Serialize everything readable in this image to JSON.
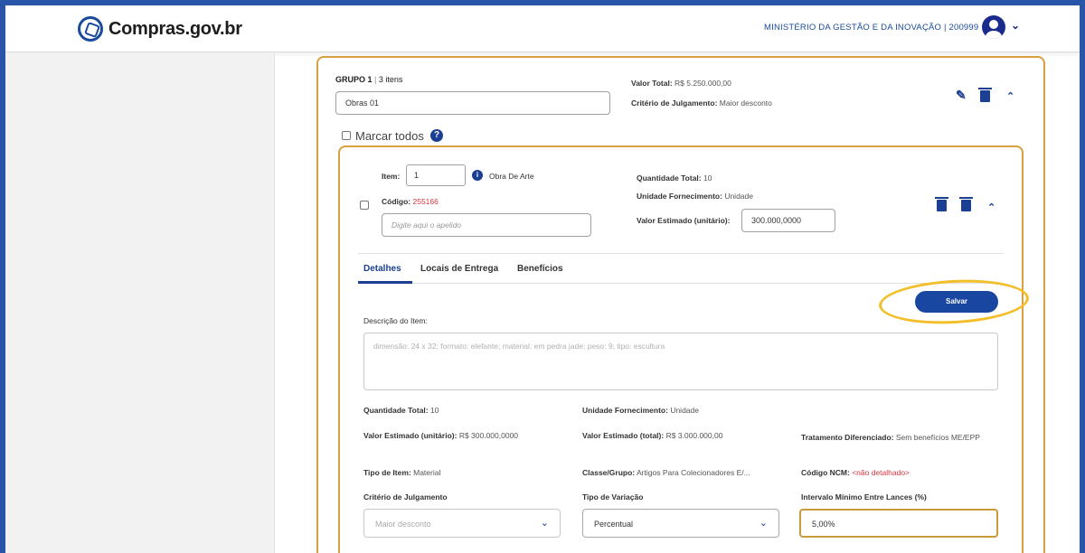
{
  "header": {
    "logo_text": "Compras.gov.br",
    "ministry": "MINISTÉRIO DA GESTÃO E DA INOVAÇÃO | 200999"
  },
  "group": {
    "title": "GRUPO 1",
    "count": "3 itens",
    "name_value": "Obras 01",
    "valor_total_label": "Valor Total:",
    "valor_total": "R$ 5.250.000,00",
    "criterio_label": "Critério de Julgamento:",
    "criterio": "Maior desconto",
    "marcar_todos": "Marcar todos"
  },
  "item": {
    "item_label": "Item:",
    "item_number": "1",
    "obra": "Obra De Arte",
    "codigo_label": "Código:",
    "codigo": "255166",
    "apelido_placeholder": "Digite aqui o apelido",
    "quantidade_label": "Quantidade Total:",
    "quantidade": "10",
    "unidade_label": "Unidade Fornecimento:",
    "unidade": "Unidade",
    "valor_unit_label": "Valor Estimado (unitário):",
    "valor_unit": "300.000,0000"
  },
  "tabs": [
    "Detalhes",
    "Locais de Entrega",
    "Benefícios"
  ],
  "save_label": "Salvar",
  "details": {
    "descricao_label": "Descrição do Item:",
    "descricao": "dimensão: 24 x 32; formato: elefante; material: em pedra jade; peso: 9; tipo: escultura",
    "qt_label": "Quantidade Total:",
    "qt": "10",
    "uf_label": "Unidade Fornecimento:",
    "uf": "Unidade",
    "vu_label": "Valor Estimado (unitário):",
    "vu": "R$ 300.000,0000",
    "vt_label": "Valor Estimado (total):",
    "vt": "R$ 3.000.000,00",
    "trat_label": "Tratamento Diferenciado:",
    "trat": "Sem benefícios ME/EPP",
    "tipo_label": "Tipo de Item:",
    "tipo": "Material",
    "classe_label": "Classe/Grupo:",
    "classe": "Artigos Para Colecionadores E/...",
    "ncm_label": "Código NCM:",
    "ncm": "<não detalhado>",
    "criterio_label": "Critério de Julgamento",
    "criterio": "Maior desconto",
    "variacao_label": "Tipo de Variação",
    "variacao": "Percentual",
    "intervalo_label": "Intervalo Mínimo Entre Lances (%)",
    "intervalo": "5,00%"
  }
}
